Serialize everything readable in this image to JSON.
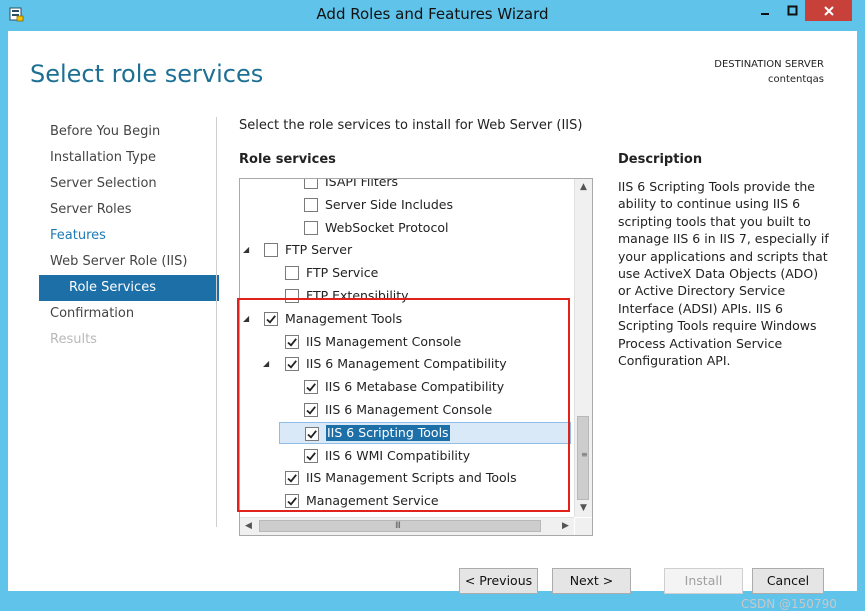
{
  "window": {
    "title": "Add Roles and Features Wizard",
    "controls": {
      "minimize": "minimize-icon",
      "maximize": "maximize-icon",
      "close": "close-icon"
    }
  },
  "header": {
    "page_title": "Select role services",
    "destination_label": "DESTINATION SERVER",
    "destination_server": "contentqas"
  },
  "nav": {
    "items": [
      {
        "label": "Before You Begin",
        "state": "normal"
      },
      {
        "label": "Installation Type",
        "state": "normal"
      },
      {
        "label": "Server Selection",
        "state": "normal"
      },
      {
        "label": "Server Roles",
        "state": "normal"
      },
      {
        "label": "Features",
        "state": "link"
      },
      {
        "label": "Web Server Role (IIS)",
        "state": "normal"
      },
      {
        "label": "Role Services",
        "state": "selected"
      },
      {
        "label": "Confirmation",
        "state": "normal"
      },
      {
        "label": "Results",
        "state": "disabled"
      }
    ]
  },
  "main": {
    "instruction": "Select the role services to install for Web Server (IIS)",
    "role_services_header": "Role services",
    "tree": [
      {
        "label": "ISAPI Filters",
        "checked": false,
        "expander": "",
        "level": 3
      },
      {
        "label": "Server Side Includes",
        "checked": false,
        "expander": "",
        "level": 3
      },
      {
        "label": "WebSocket Protocol",
        "checked": false,
        "expander": "",
        "level": 3
      },
      {
        "label": "FTP Server",
        "checked": false,
        "expander": "◢",
        "level": 1
      },
      {
        "label": "FTP Service",
        "checked": false,
        "expander": "",
        "level": 2
      },
      {
        "label": "FTP Extensibility",
        "checked": false,
        "expander": "",
        "level": 2
      },
      {
        "label": "Management Tools",
        "checked": true,
        "expander": "◢",
        "level": 1
      },
      {
        "label": "IIS Management Console",
        "checked": true,
        "expander": "",
        "level": 2
      },
      {
        "label": "IIS 6 Management Compatibility",
        "checked": true,
        "expander": "◢",
        "level": 2
      },
      {
        "label": "IIS 6 Metabase Compatibility",
        "checked": true,
        "expander": "",
        "level": 3
      },
      {
        "label": "IIS 6 Management Console",
        "checked": true,
        "expander": "",
        "level": 3
      },
      {
        "label": "IIS 6 Scripting Tools",
        "checked": true,
        "expander": "",
        "level": 3,
        "selected": true
      },
      {
        "label": "IIS 6 WMI Compatibility",
        "checked": true,
        "expander": "",
        "level": 3
      },
      {
        "label": "IIS Management Scripts and Tools",
        "checked": true,
        "expander": "",
        "level": 2
      },
      {
        "label": "Management Service",
        "checked": true,
        "expander": "",
        "level": 2
      }
    ],
    "scroll": {
      "up_arrow": "▲",
      "down_arrow": "▼",
      "left_arrow": "◀",
      "right_arrow": "▶",
      "v_grip": "≡",
      "h_grip": "III"
    }
  },
  "description": {
    "header": "Description",
    "text": "IIS 6 Scripting Tools provide the ability to continue using IIS 6 scripting tools that you built to manage IIS 6 in IIS 7, especially if your applications and scripts that use ActiveX Data Objects (ADO) or Active Directory Service Interface (ADSI) APIs. IIS 6 Scripting Tools require Windows Process Activation Service Configuration API."
  },
  "footer": {
    "previous": "< Previous",
    "next": "Next >",
    "install": "Install",
    "cancel": "Cancel"
  },
  "watermark": "CSDN @150790",
  "colors": {
    "titlebar": "#5fc3ea",
    "accent": "#1d6fa8",
    "close": "#c7413a",
    "highlight_frame": "#e0221b"
  }
}
